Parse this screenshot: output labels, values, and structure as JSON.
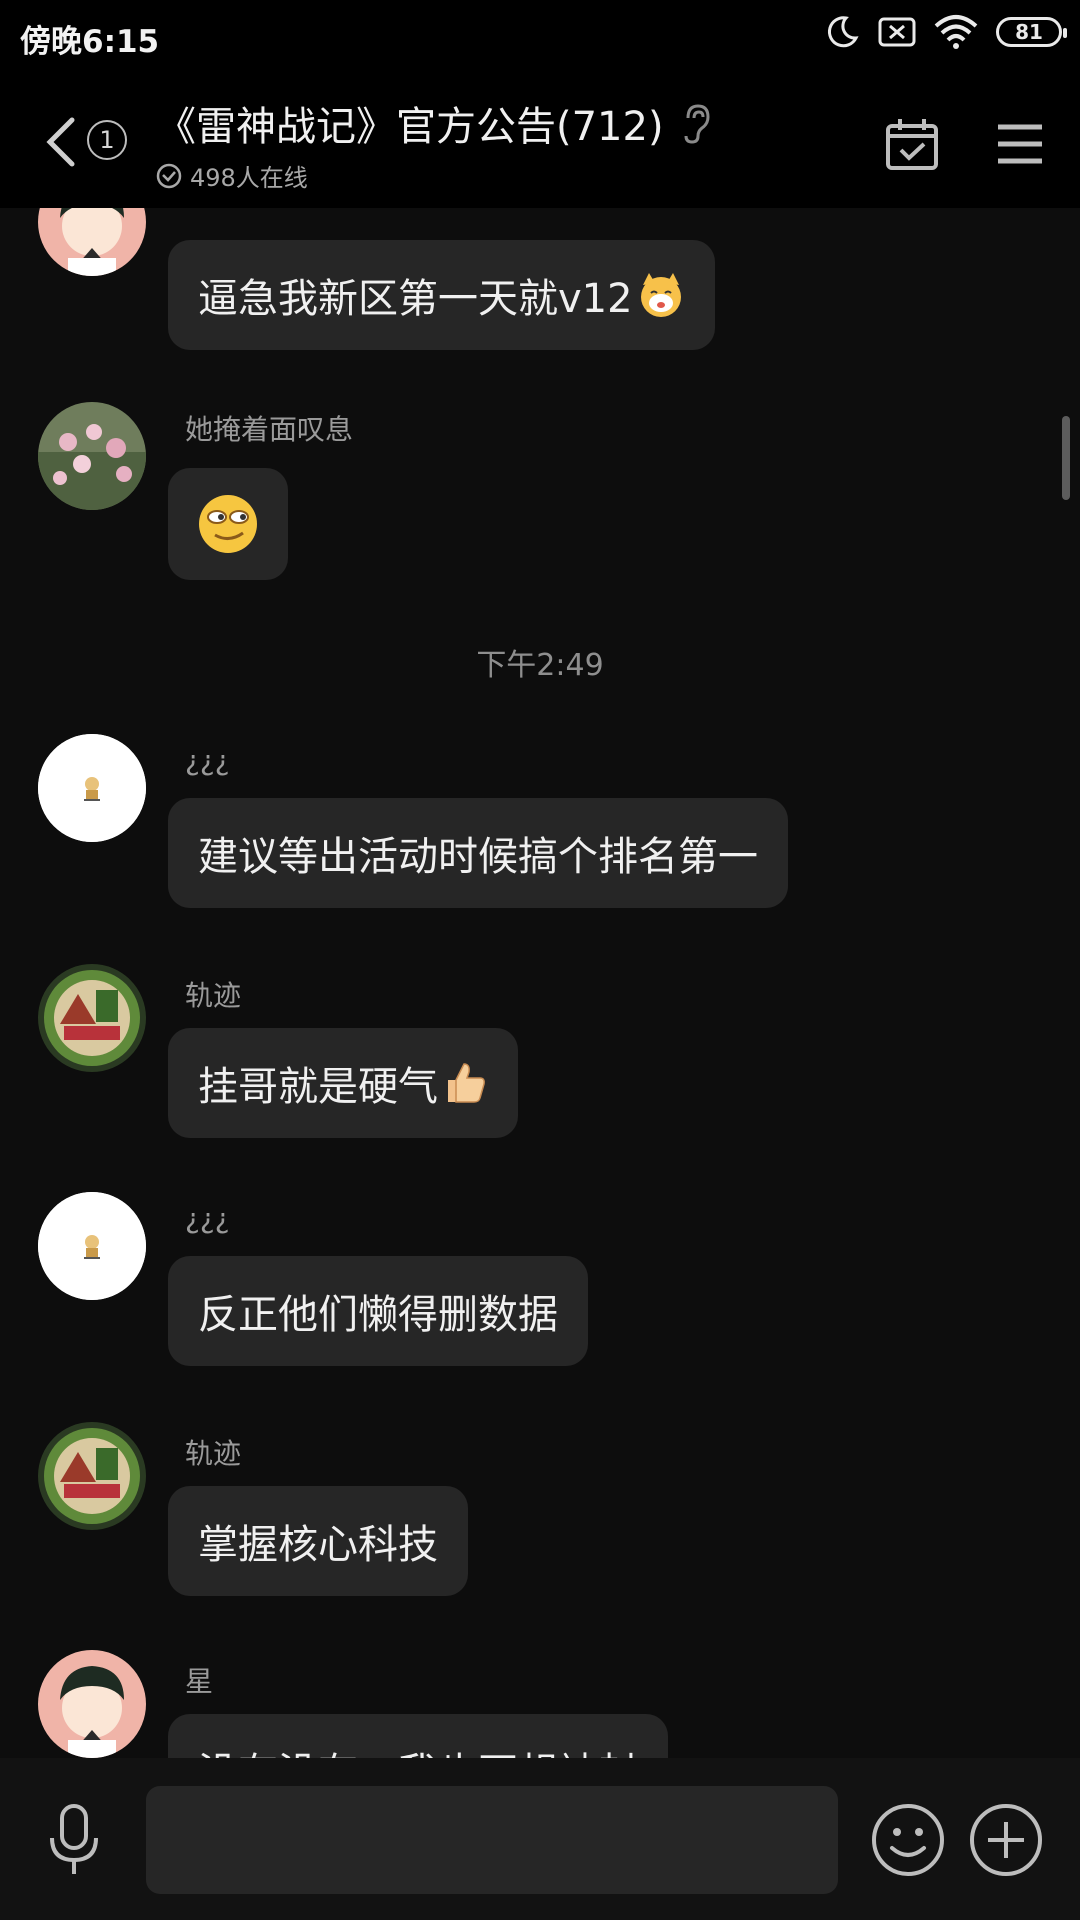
{
  "status_bar": {
    "time": "傍晚6:15",
    "battery": "81"
  },
  "header": {
    "unread_count": "1",
    "title": "《雷神战记》官方公告(712)",
    "online_text": "498人在线"
  },
  "messages": [
    {
      "sender": "",
      "text": "逼急我新区第一天就v12",
      "avatar": "anime-boy"
    },
    {
      "sender": "她掩着面叹息",
      "text": "",
      "avatar": "flowers"
    },
    {
      "sender": "¿¿¿",
      "text": "建议等出活动时候搞个排名第一",
      "avatar": "white"
    },
    {
      "sender": "轨迹",
      "text": "挂哥就是硬气",
      "avatar": "watermelon"
    },
    {
      "sender": "¿¿¿",
      "text": "反正他们懒得删数据",
      "avatar": "white"
    },
    {
      "sender": "轨迹",
      "text": "掌握核心科技",
      "avatar": "watermelon"
    },
    {
      "sender": "星",
      "text": "没有没有，我也不想被封",
      "avatar": "anime-boy"
    }
  ],
  "timestamp": "下午2:49"
}
